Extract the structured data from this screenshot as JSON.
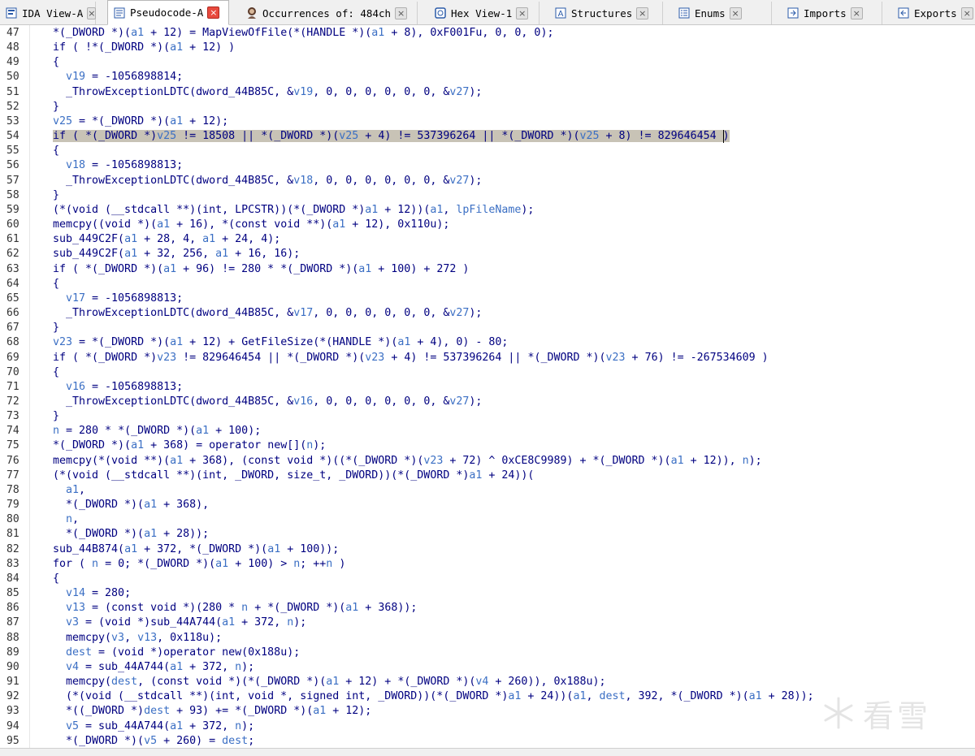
{
  "tabs": [
    {
      "label": "IDA View-A",
      "icon": "ida-view-icon",
      "active": false
    },
    {
      "label": "Pseudocode-A",
      "icon": "pseudocode-icon",
      "active": true
    },
    {
      "label": "Occurrences of: 484ch",
      "icon": "occurrences-icon",
      "active": false
    },
    {
      "label": "Hex View-1",
      "icon": "hex-view-icon",
      "active": false
    },
    {
      "label": "Structures",
      "icon": "structures-icon",
      "active": false
    },
    {
      "label": "Enums",
      "icon": "enums-icon",
      "active": false
    },
    {
      "label": "Imports",
      "icon": "imports-icon",
      "active": false
    },
    {
      "label": "Exports",
      "icon": "exports-icon",
      "active": false
    }
  ],
  "code": {
    "highlighted_line": 54,
    "lines": [
      {
        "n": "47",
        "indent": 0,
        "text": "*(_DWORD *)(a1 + 12) = MapViewOfFile(*(HANDLE *)(a1 + 8), 0xF001Fu, 0, 0, 0);"
      },
      {
        "n": "48",
        "indent": 0,
        "text": "if ( !*(_DWORD *)(a1 + 12) )"
      },
      {
        "n": "49",
        "indent": 0,
        "text": "{"
      },
      {
        "n": "50",
        "indent": 1,
        "text": "v19 = -1056898814;"
      },
      {
        "n": "51",
        "indent": 1,
        "text": "_ThrowExceptionLDTC(dword_44B85C, &v19, 0, 0, 0, 0, 0, 0, &v27);"
      },
      {
        "n": "52",
        "indent": 0,
        "text": "}"
      },
      {
        "n": "53",
        "indent": 0,
        "text": "v25 = *(_DWORD *)(a1 + 12);"
      },
      {
        "n": "54",
        "indent": 0,
        "text": "if ( *(_DWORD *)v25 != 18508 || *(_DWORD *)(v25 + 4) != 537396264 || *(_DWORD *)(v25 + 8) != 829646454 )"
      },
      {
        "n": "55",
        "indent": 0,
        "text": "{"
      },
      {
        "n": "56",
        "indent": 1,
        "text": "v18 = -1056898813;"
      },
      {
        "n": "57",
        "indent": 1,
        "text": "_ThrowExceptionLDTC(dword_44B85C, &v18, 0, 0, 0, 0, 0, 0, &v27);"
      },
      {
        "n": "58",
        "indent": 0,
        "text": "}"
      },
      {
        "n": "59",
        "indent": 0,
        "text": "(*(void (__stdcall **)(int, LPCSTR))(*(_DWORD *)a1 + 12))(a1, lpFileName);"
      },
      {
        "n": "60",
        "indent": 0,
        "text": "memcpy((void *)(a1 + 16), *(const void **)(a1 + 12), 0x110u);"
      },
      {
        "n": "61",
        "indent": 0,
        "text": "sub_449C2F(a1 + 28, 4, a1 + 24, 4);"
      },
      {
        "n": "62",
        "indent": 0,
        "text": "sub_449C2F(a1 + 32, 256, a1 + 16, 16);"
      },
      {
        "n": "63",
        "indent": 0,
        "text": "if ( *(_DWORD *)(a1 + 96) != 280 * *(_DWORD *)(a1 + 100) + 272 )"
      },
      {
        "n": "64",
        "indent": 0,
        "text": "{"
      },
      {
        "n": "65",
        "indent": 1,
        "text": "v17 = -1056898813;"
      },
      {
        "n": "66",
        "indent": 1,
        "text": "_ThrowExceptionLDTC(dword_44B85C, &v17, 0, 0, 0, 0, 0, 0, &v27);"
      },
      {
        "n": "67",
        "indent": 0,
        "text": "}"
      },
      {
        "n": "68",
        "indent": 0,
        "text": "v23 = *(_DWORD *)(a1 + 12) + GetFileSize(*(HANDLE *)(a1 + 4), 0) - 80;"
      },
      {
        "n": "69",
        "indent": 0,
        "text": "if ( *(_DWORD *)v23 != 829646454 || *(_DWORD *)(v23 + 4) != 537396264 || *(_DWORD *)(v23 + 76) != -267534609 )"
      },
      {
        "n": "70",
        "indent": 0,
        "text": "{"
      },
      {
        "n": "71",
        "indent": 1,
        "text": "v16 = -1056898813;"
      },
      {
        "n": "72",
        "indent": 1,
        "text": "_ThrowExceptionLDTC(dword_44B85C, &v16, 0, 0, 0, 0, 0, 0, &v27);"
      },
      {
        "n": "73",
        "indent": 0,
        "text": "}"
      },
      {
        "n": "74",
        "indent": 0,
        "text": "n = 280 * *(_DWORD *)(a1 + 100);"
      },
      {
        "n": "75",
        "indent": 0,
        "text": "*(_DWORD *)(a1 + 368) = operator new[](n);"
      },
      {
        "n": "76",
        "indent": 0,
        "text": "memcpy(*(void **)(a1 + 368), (const void *)((*(_DWORD *)(v23 + 72) ^ 0xCE8C9989) + *(_DWORD *)(a1 + 12)), n);"
      },
      {
        "n": "77",
        "indent": 0,
        "text": "(*(void (__stdcall **)(int, _DWORD, size_t, _DWORD))(*(_DWORD *)a1 + 24))("
      },
      {
        "n": "78",
        "indent": 1,
        "text": "a1,"
      },
      {
        "n": "79",
        "indent": 1,
        "text": "*(_DWORD *)(a1 + 368),"
      },
      {
        "n": "80",
        "indent": 1,
        "text": "n,"
      },
      {
        "n": "81",
        "indent": 1,
        "text": "*(_DWORD *)(a1 + 28));"
      },
      {
        "n": "82",
        "indent": 0,
        "text": "sub_44B874(a1 + 372, *(_DWORD *)(a1 + 100));"
      },
      {
        "n": "83",
        "indent": 0,
        "text": "for ( n = 0; *(_DWORD *)(a1 + 100) > n; ++n )"
      },
      {
        "n": "84",
        "indent": 0,
        "text": "{"
      },
      {
        "n": "85",
        "indent": 1,
        "text": "v14 = 280;"
      },
      {
        "n": "86",
        "indent": 1,
        "text": "v13 = (const void *)(280 * n + *(_DWORD *)(a1 + 368));"
      },
      {
        "n": "87",
        "indent": 1,
        "text": "v3 = (void *)sub_44A744(a1 + 372, n);"
      },
      {
        "n": "88",
        "indent": 1,
        "text": "memcpy(v3, v13, 0x118u);"
      },
      {
        "n": "89",
        "indent": 1,
        "text": "dest = (void *)operator new(0x188u);"
      },
      {
        "n": "90",
        "indent": 1,
        "text": "v4 = sub_44A744(a1 + 372, n);"
      },
      {
        "n": "91",
        "indent": 1,
        "text": "memcpy(dest, (const void *)(*(_DWORD *)(a1 + 12) + *(_DWORD *)(v4 + 260)), 0x188u);"
      },
      {
        "n": "92",
        "indent": 1,
        "text": "(*(void (__stdcall **)(int, void *, signed int, _DWORD))(*(_DWORD *)a1 + 24))(a1, dest, 392, *(_DWORD *)(a1 + 28));"
      },
      {
        "n": "93",
        "indent": 1,
        "text": "*((_DWORD *)dest + 93) += *(_DWORD *)(a1 + 12);"
      },
      {
        "n": "94",
        "indent": 1,
        "text": "v5 = sub_44A744(a1 + 372, n);"
      },
      {
        "n": "95",
        "indent": 1,
        "text": "*(_DWORD *)(v5 + 260) = dest;"
      }
    ]
  },
  "watermark": {
    "text": "看雪"
  },
  "colors": {
    "code_text": "#000080",
    "variable": "#3b6fc4",
    "highlight_bg": "#c8c3b6",
    "active_tab_close": "#e84a3e"
  }
}
